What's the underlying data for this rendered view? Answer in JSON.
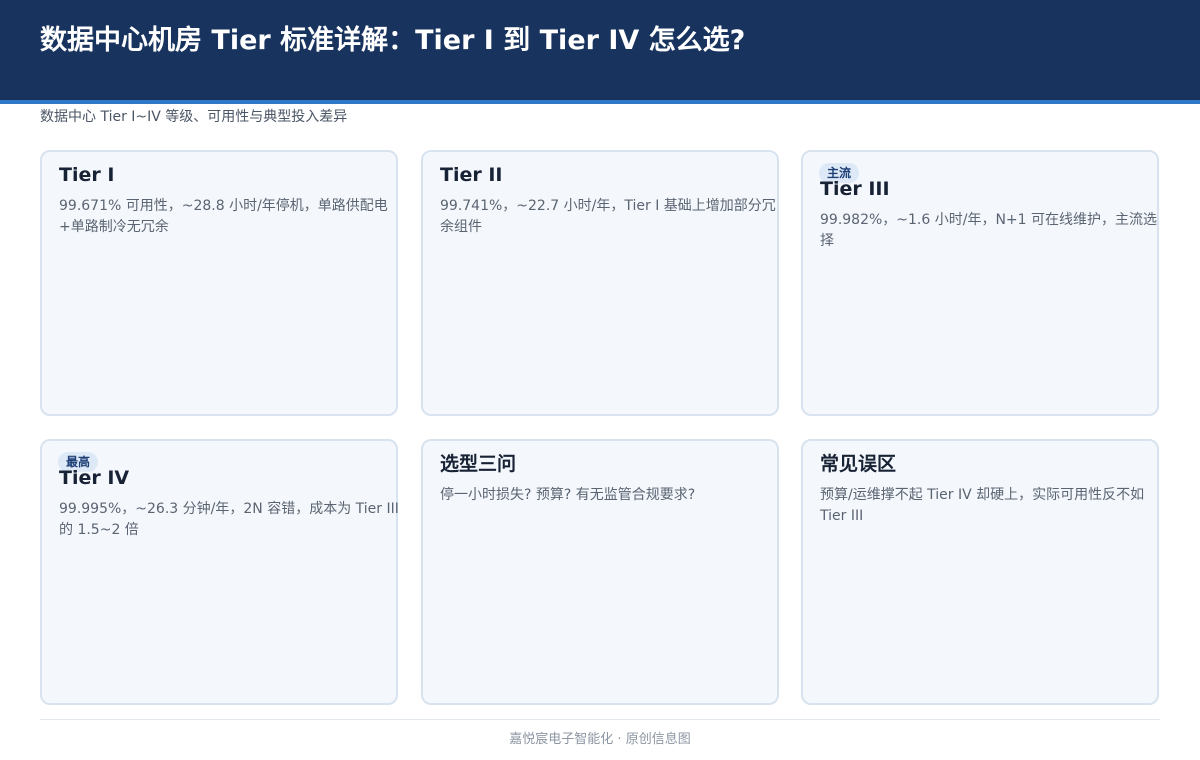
{
  "header": {
    "title": "数据中心机房 Tier 标准详解：Tier I 到 Tier IV 怎么选?",
    "subtitle": "数据中心 Tier I~IV 等级、可用性与典型投入差异"
  },
  "cards": [
    {
      "badge": "",
      "title": "Tier I",
      "body": "99.671% 可用性，~28.8 小时/年停机，单路供配电+单路制冷无冗余"
    },
    {
      "badge": "",
      "title": "Tier II",
      "body": "99.741%，~22.7 小时/年，Tier I 基础上增加部分冗余组件"
    },
    {
      "badge": "主流",
      "title": "Tier III",
      "body": "99.982%，~1.6 小时/年，N+1 可在线维护，主流选择"
    },
    {
      "badge": "最高",
      "title": "Tier IV",
      "body": "99.995%，~26.3 分钟/年，2N 容错，成本为 Tier III 的 1.5~2 倍"
    },
    {
      "badge": "",
      "title": "选型三问",
      "body": "停一小时损失? 预算? 有无监管合规要求?"
    },
    {
      "badge": "",
      "title": "常见误区",
      "body": "预算/运维撑不起 Tier IV 却硬上，实际可用性反不如 Tier III"
    }
  ],
  "footer": {
    "text": "嘉悦宸电子智能化 · 原创信息图"
  },
  "colors": {
    "header_bg": "#17335e",
    "accent": "#2f78c7",
    "card_bg": "#f4f8fc",
    "card_border": "#d8e3ef",
    "badge_bg": "#dde9f7",
    "badge_text": "#1d3f76"
  }
}
